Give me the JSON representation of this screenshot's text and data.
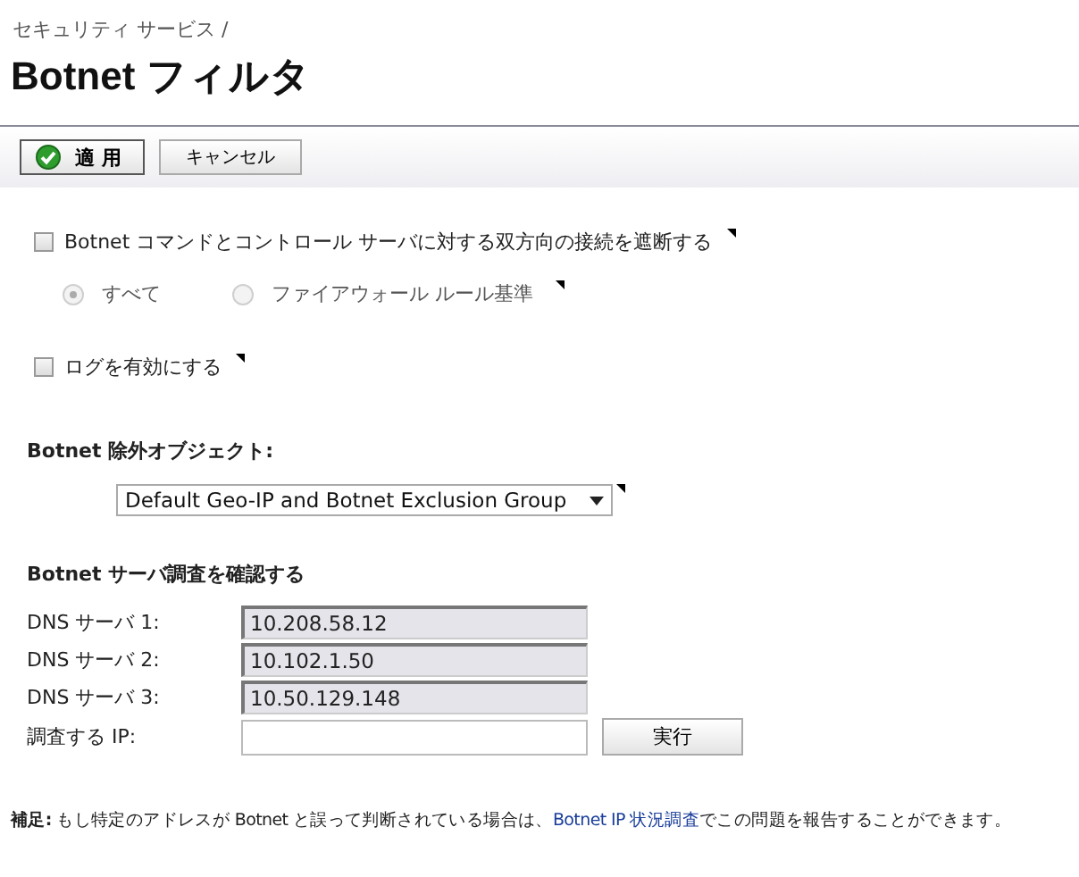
{
  "breadcrumb": "セキュリティ サービス /",
  "title": "Botnet フィルタ",
  "toolbar": {
    "buttons": [
      {
        "label": "適 用",
        "kind": "primary"
      },
      {
        "label": "キャンセル",
        "kind": "plain"
      }
    ]
  },
  "block_option": {
    "label": "Botnet コマンドとコントロール サーバに対する双方向の接続を遮断する",
    "checked": false
  },
  "block_scope": [
    {
      "label": "すべて",
      "selected": true,
      "disabled": true
    },
    {
      "label": "ファイアウォール ルール基準",
      "selected": false,
      "disabled": true
    }
  ],
  "log_option": {
    "label": "ログを有効にする",
    "checked": false
  },
  "exclusion": {
    "heading": "Botnet 除外オブジェクト:",
    "value": "Default Geo-IP and Botnet Exclusion Group"
  },
  "lookup": {
    "heading": "Botnet サーバ調査を確認する",
    "dns_servers": [
      {
        "label": "DNS サーバ 1:",
        "value": "10.208.58.12",
        "disabled": true
      },
      {
        "label": "DNS サーバ 2:",
        "value": "10.102.1.50",
        "disabled": true
      },
      {
        "label": "DNS サーバ 3:",
        "value": "10.50.129.148",
        "disabled": true
      }
    ],
    "ip_label": "調査する IP:",
    "run_button": "実行"
  },
  "note": {
    "label": "補足:",
    "text_before": "もし特定のアドレスが Botnet と誤って判断されている場合は、",
    "link": "Botnet IP 状況調査",
    "text_after": "でこの問題を報告することができます。"
  }
}
